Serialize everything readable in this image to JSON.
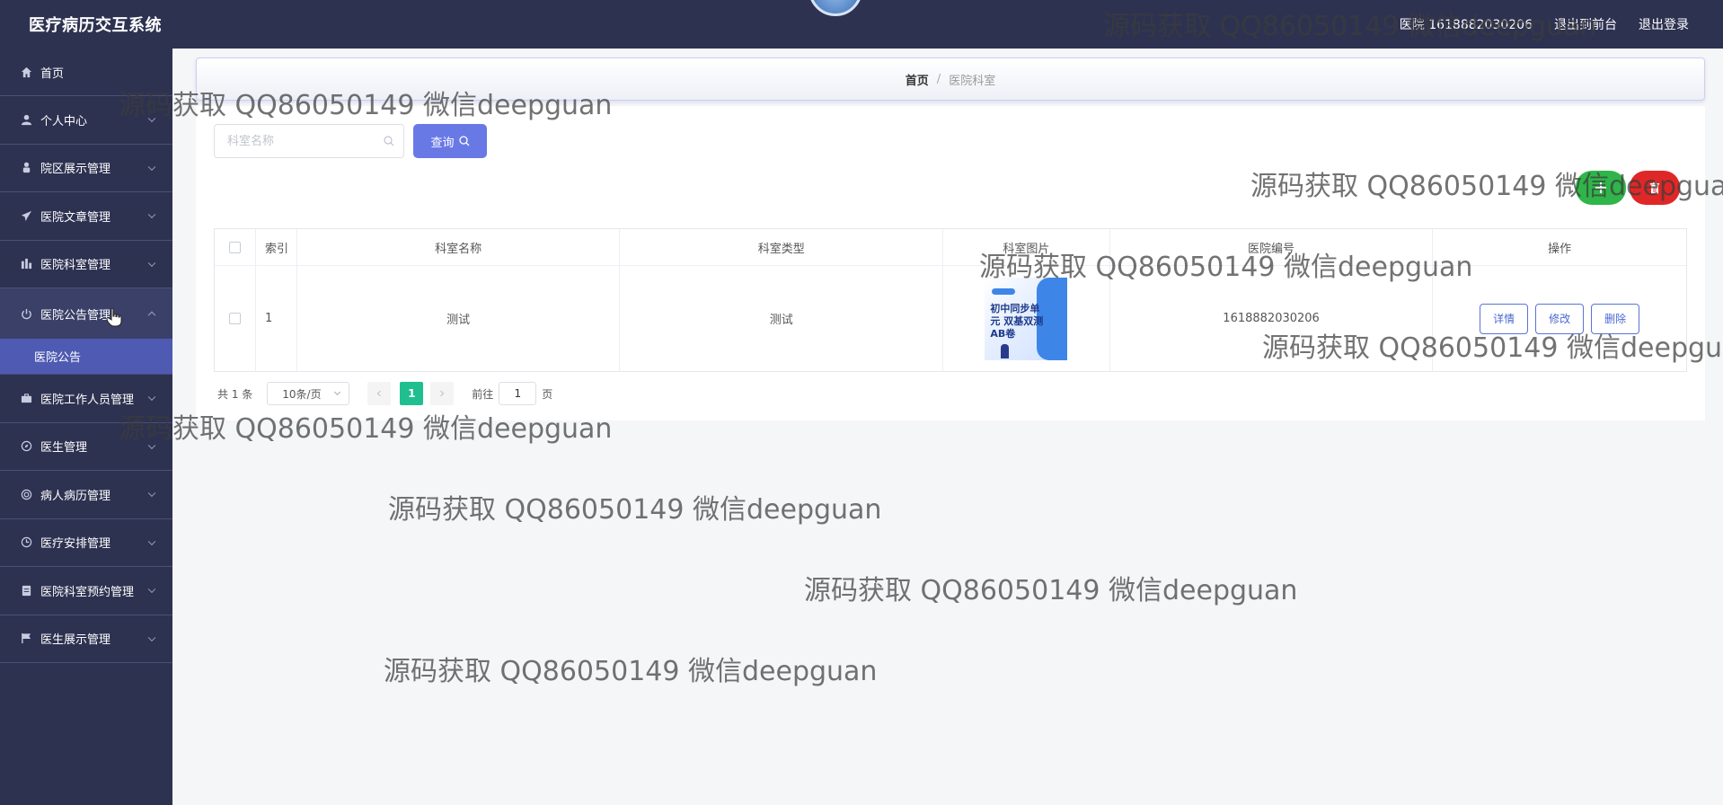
{
  "header": {
    "app_title": "医疗病历交互系统",
    "user_label": "医院 1618882030206",
    "back_front_label": "退出到前台",
    "logout_label": "退出登录"
  },
  "sidebar": {
    "items": [
      {
        "label": "首页",
        "icon": "home-icon"
      },
      {
        "label": "个人中心",
        "icon": "user-icon"
      },
      {
        "label": "院区展示管理",
        "icon": "person-icon"
      },
      {
        "label": "医院文章管理",
        "icon": "send-icon"
      },
      {
        "label": "医院科室管理",
        "icon": "stats-icon"
      },
      {
        "label": "医院公告管理",
        "icon": "power-icon",
        "expanded": true
      },
      {
        "label": "医院工作人员管理",
        "icon": "briefcase-icon"
      },
      {
        "label": "医生管理",
        "icon": "compass-icon"
      },
      {
        "label": "病人病历管理",
        "icon": "target-icon"
      },
      {
        "label": "医疗安排管理",
        "icon": "clock-icon"
      },
      {
        "label": "医院科室预约管理",
        "icon": "document-icon"
      },
      {
        "label": "医生展示管理",
        "icon": "flag-icon"
      }
    ],
    "subitem": "医院公告"
  },
  "breadcrumb": {
    "home": "首页",
    "separator": "/",
    "current": "医院科室"
  },
  "search": {
    "placeholder": "科室名称",
    "value": "",
    "query_label": "查询"
  },
  "table": {
    "headers": [
      "索引",
      "科室名称",
      "科室类型",
      "科室图片",
      "医院编号",
      "操作"
    ],
    "rows": [
      {
        "index": "1",
        "name": "测试",
        "type": "测试",
        "image_caption": "初中同步单元 双基双测AB卷",
        "hospital_id": "1618882030206"
      }
    ],
    "actions": {
      "detail": "详情",
      "edit": "修改",
      "delete": "删除"
    }
  },
  "pagination": {
    "total": "共 1 条",
    "page_size": "10条/页",
    "current_page": "1",
    "goto_label": "前往",
    "goto_value": "1",
    "page_suffix": "页"
  },
  "watermark": "源码获取 QQ86050149 微信deepguan",
  "colors": {
    "header_bg": "#2e3251",
    "submenu_active": "#4f5bb2",
    "query_btn": "#6879e6",
    "add_btn": "#2fb54a",
    "delete_btn": "#e02727",
    "page_active": "#1fbf8f"
  }
}
